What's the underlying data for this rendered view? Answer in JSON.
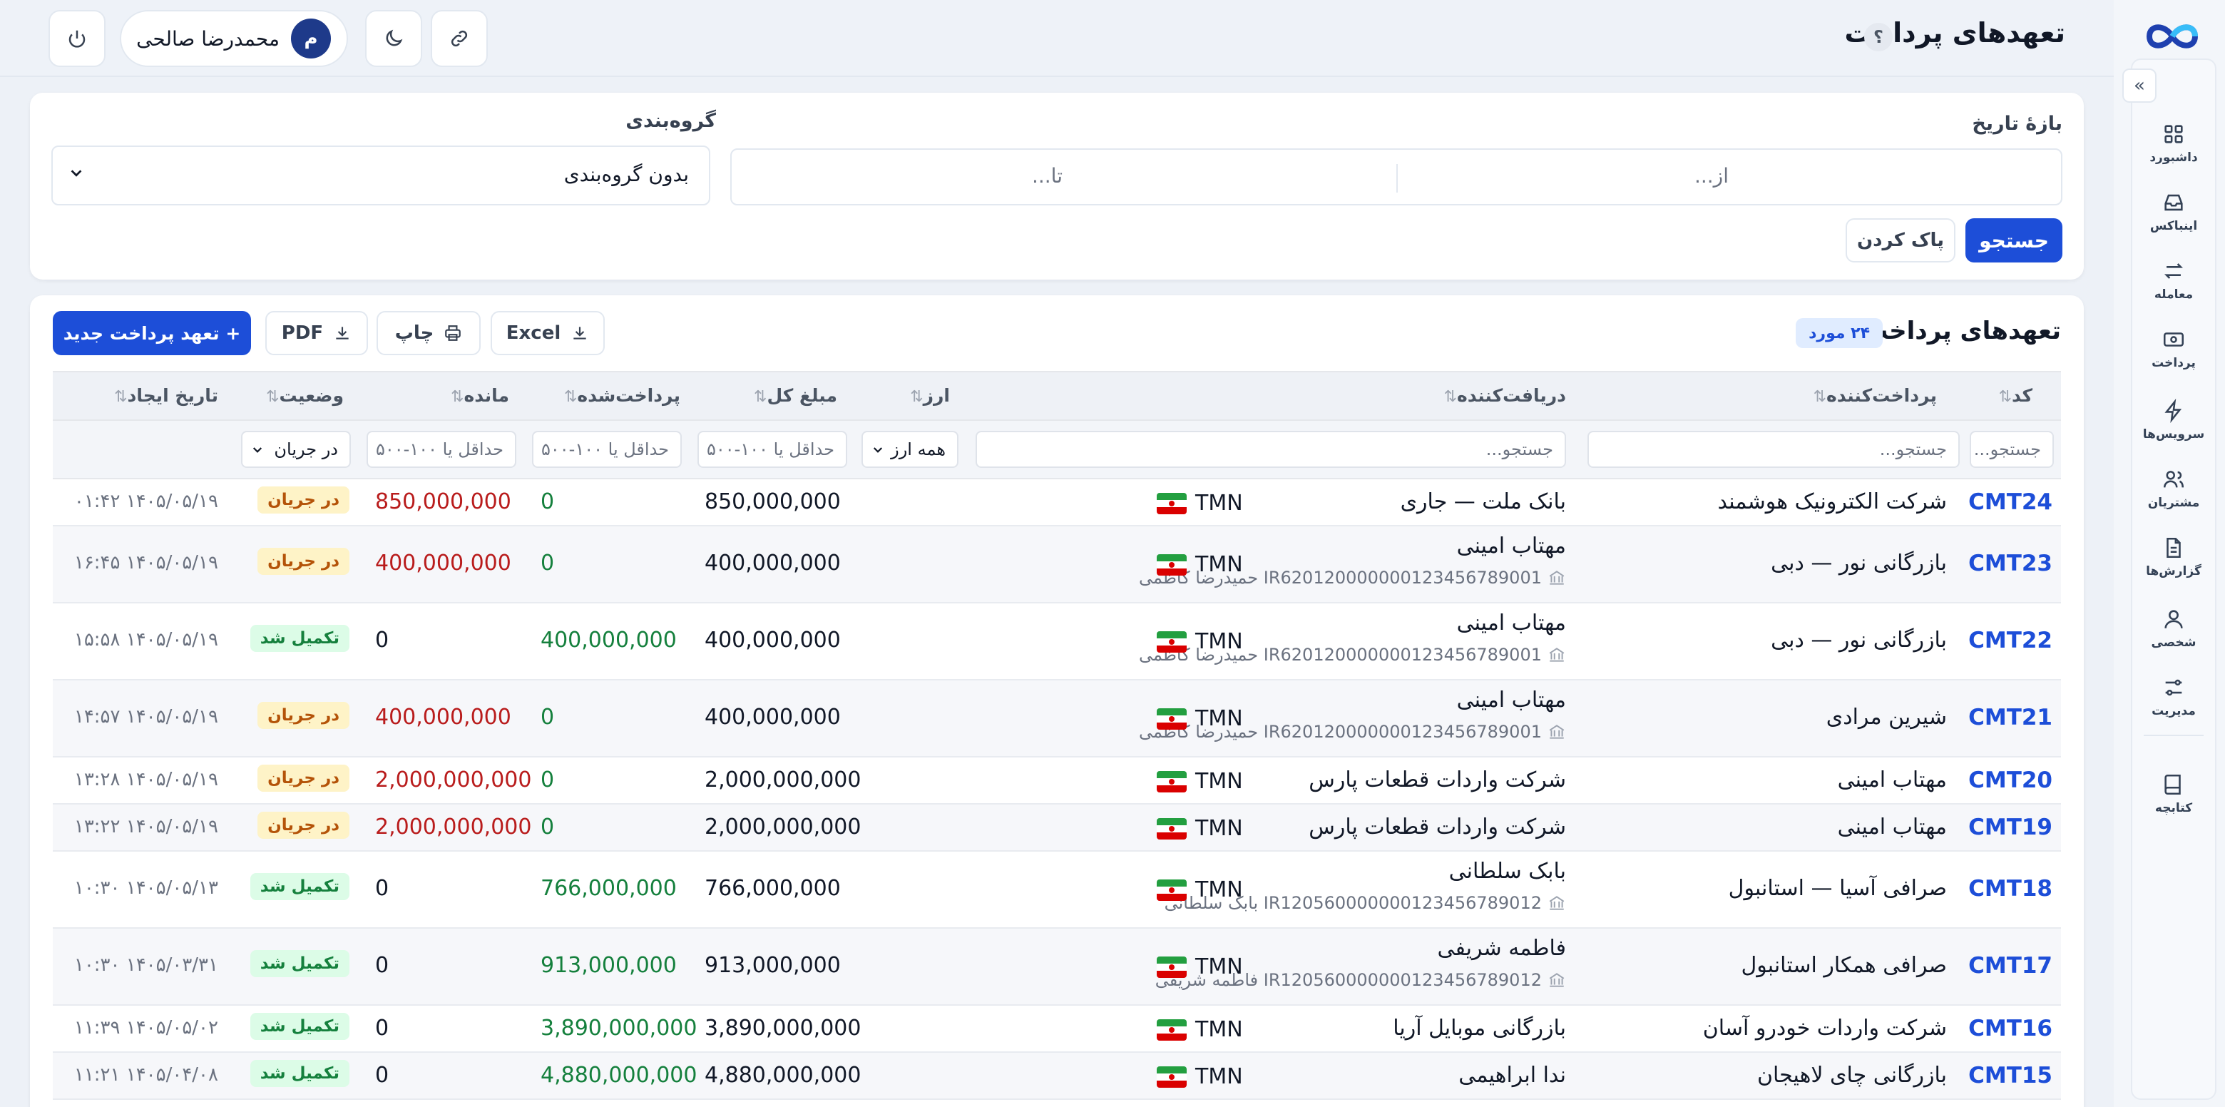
{
  "app": {
    "page_title": "تعهدهای پرداخت",
    "help": "؟"
  },
  "sidebar": {
    "collapse": "»",
    "items": [
      {
        "key": "dashboard",
        "label": "داشبورد",
        "icon": "grid-icon"
      },
      {
        "key": "inbox",
        "label": "اینباکس",
        "icon": "inbox-icon"
      },
      {
        "key": "trade",
        "label": "معامله",
        "icon": "swap-icon"
      },
      {
        "key": "payment",
        "label": "پرداخت",
        "icon": "cash-icon"
      },
      {
        "key": "services",
        "label": "سرویس‌ها",
        "icon": "bolt-icon"
      },
      {
        "key": "customers",
        "label": "مشتریان",
        "icon": "users-icon"
      },
      {
        "key": "reports",
        "label": "گزارش‌ها",
        "icon": "document-icon"
      },
      {
        "key": "personal",
        "label": "شخصی",
        "icon": "user-icon"
      },
      {
        "key": "admin",
        "label": "مدیریت",
        "icon": "sliders-icon"
      },
      {
        "key": "handbook",
        "label": "کتابچه",
        "icon": "book-icon"
      }
    ]
  },
  "header": {
    "user": {
      "name": "محمدرضا صالحی",
      "initial": "م"
    }
  },
  "filters": {
    "date_range_label": "بازهٔ تاریخ",
    "from_placeholder": "از...",
    "to_placeholder": "تا...",
    "grouping_label": "گروه‌بندی",
    "grouping_value": "بدون گروه‌بندی",
    "search_button": "جستجو",
    "clear_button": "پاک کردن"
  },
  "table": {
    "title": "تعهدهای پرداخت",
    "count": "۲۴ مورد",
    "new_button": "+ تعهد پرداخت جدید",
    "export_excel": "Excel",
    "print": "چاپ",
    "export_pdf": "PDF",
    "columns": {
      "code": "کد",
      "payer": "پرداخت‌کننده",
      "receiver": "دریافت‌کننده",
      "currency": "ارز",
      "total": "مبلغ کل",
      "paid": "پرداخت‌شده",
      "remaining": "مانده",
      "status": "وضعیت",
      "created": "تاریخ ایجاد"
    },
    "column_filters": {
      "code": "جستجو...",
      "payer": "جستجو...",
      "receiver": "جستجو...",
      "currency": "همه ارز",
      "total": "حداقل یا ۱۰۰-۵۰۰",
      "paid": "حداقل یا ۱۰۰-۵۰۰",
      "remaining": "حداقل یا ۱۰۰-۵۰۰",
      "status": "در جریان"
    },
    "rows": [
      {
        "code": "CMT24",
        "payer": "شرکت الکترونیک هوشمند",
        "receiver": "بانک ملت — جاری",
        "receiver_sub": "",
        "currency": "TMN",
        "total": "850,000,000",
        "paid": "0",
        "remaining": "850,000,000",
        "status": "در جریان",
        "status_kind": "pending",
        "created": "۱۴۰۵/۰۵/۱۹ ۰۱:۴۲"
      },
      {
        "code": "CMT23",
        "payer": "بازرگانی نور — دبی",
        "receiver": "مهتاب امینی",
        "receiver_sub": "IR620120000000123456789001 حمیدرضا کاظمی",
        "currency": "TMN",
        "total": "400,000,000",
        "paid": "0",
        "remaining": "400,000,000",
        "status": "در جریان",
        "status_kind": "pending",
        "created": "۱۴۰۵/۰۵/۱۹ ۱۶:۴۵"
      },
      {
        "code": "CMT22",
        "payer": "بازرگانی نور — دبی",
        "receiver": "مهتاب امینی",
        "receiver_sub": "IR620120000000123456789001 حمیدرضا کاظمی",
        "currency": "TMN",
        "total": "400,000,000",
        "paid": "400,000,000",
        "remaining": "0",
        "status": "تکمیل شد",
        "status_kind": "done",
        "created": "۱۴۰۵/۰۵/۱۹ ۱۵:۵۸"
      },
      {
        "code": "CMT21",
        "payer": "شیرین مرادی",
        "receiver": "مهتاب امینی",
        "receiver_sub": "IR620120000000123456789001 حمیدرضا کاظمی",
        "currency": "TMN",
        "total": "400,000,000",
        "paid": "0",
        "remaining": "400,000,000",
        "status": "در جریان",
        "status_kind": "pending",
        "created": "۱۴۰۵/۰۵/۱۹ ۱۴:۵۷"
      },
      {
        "code": "CMT20",
        "payer": "مهتاب امینی",
        "receiver": "شرکت واردات قطعات پارس",
        "receiver_sub": "",
        "currency": "TMN",
        "total": "2,000,000,000",
        "paid": "0",
        "remaining": "2,000,000,000",
        "status": "در جریان",
        "status_kind": "pending",
        "created": "۱۴۰۵/۰۵/۱۹ ۱۳:۲۸"
      },
      {
        "code": "CMT19",
        "payer": "مهتاب امینی",
        "receiver": "شرکت واردات قطعات پارس",
        "receiver_sub": "",
        "currency": "TMN",
        "total": "2,000,000,000",
        "paid": "0",
        "remaining": "2,000,000,000",
        "status": "در جریان",
        "status_kind": "pending",
        "created": "۱۴۰۵/۰۵/۱۹ ۱۳:۲۲"
      },
      {
        "code": "CMT18",
        "payer": "صرافی آسیا — استانبول",
        "receiver": "بابک سلطانی",
        "receiver_sub": "IR120560000000123456789012 بابک سلطانی",
        "currency": "TMN",
        "total": "766,000,000",
        "paid": "766,000,000",
        "remaining": "0",
        "status": "تکمیل شد",
        "status_kind": "done",
        "created": "۱۴۰۵/۰۵/۱۳ ۱۰:۳۰"
      },
      {
        "code": "CMT17",
        "payer": "صرافی همکار استانبول",
        "receiver": "فاطمه شریفی",
        "receiver_sub": "IR120560000000123456789012 فاطمه شریفی",
        "currency": "TMN",
        "total": "913,000,000",
        "paid": "913,000,000",
        "remaining": "0",
        "status": "تکمیل شد",
        "status_kind": "done",
        "created": "۱۴۰۵/۰۳/۳۱ ۱۰:۳۰"
      },
      {
        "code": "CMT16",
        "payer": "شرکت واردات خودرو آسان",
        "receiver": "بازرگانی موبایل آریا",
        "receiver_sub": "",
        "currency": "TMN",
        "total": "3,890,000,000",
        "paid": "3,890,000,000",
        "remaining": "0",
        "status": "تکمیل شد",
        "status_kind": "done",
        "created": "۱۴۰۵/۰۵/۰۲ ۱۱:۳۹"
      },
      {
        "code": "CMT15",
        "payer": "بازرگانی چای لاهیجان",
        "receiver": "ندا ابراهیمی",
        "receiver_sub": "",
        "currency": "TMN",
        "total": "4,880,000,000",
        "paid": "4,880,000,000",
        "remaining": "0",
        "status": "تکمیل شد",
        "status_kind": "done",
        "created": "۱۴۰۵/۰۴/۰۸ ۱۱:۲۱"
      }
    ]
  }
}
